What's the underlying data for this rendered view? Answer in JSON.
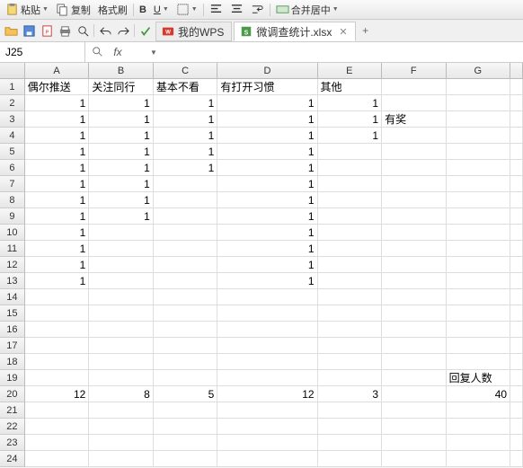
{
  "toolbar": {
    "paste_label": "粘贴",
    "copy_label": "复制",
    "format_painter_label": "格式刷",
    "merge_center_label": "合并居中"
  },
  "tabs": {
    "wps_home": "我的WPS",
    "doc_name": "微调查统计.xlsx"
  },
  "namebox": {
    "value": "J25"
  },
  "columns": [
    "A",
    "B",
    "C",
    "D",
    "E",
    "F",
    "G"
  ],
  "col_classes": [
    "cw-A",
    "cw-B",
    "cw-C",
    "cw-D",
    "cw-E",
    "cw-F",
    "cw-G"
  ],
  "row_count": 24,
  "headers_row": {
    "A": "偶尔推送",
    "B": "关注同行",
    "C": "基本不看",
    "D": "有打开习惯",
    "E": "其他"
  },
  "data": {
    "2": {
      "A": "1",
      "B": "1",
      "C": "1",
      "D": "1",
      "E": "1"
    },
    "3": {
      "A": "1",
      "B": "1",
      "C": "1",
      "D": "1",
      "E": "1",
      "F": "有奖"
    },
    "4": {
      "A": "1",
      "B": "1",
      "C": "1",
      "D": "1",
      "E": "1"
    },
    "5": {
      "A": "1",
      "B": "1",
      "C": "1",
      "D": "1"
    },
    "6": {
      "A": "1",
      "B": "1",
      "C": "1",
      "D": "1"
    },
    "7": {
      "A": "1",
      "B": "1",
      "D": "1"
    },
    "8": {
      "A": "1",
      "B": "1",
      "D": "1"
    },
    "9": {
      "A": "1",
      "B": "1",
      "D": "1"
    },
    "10": {
      "A": "1",
      "D": "1"
    },
    "11": {
      "A": "1",
      "D": "1"
    },
    "12": {
      "A": "1",
      "D": "1"
    },
    "13": {
      "A": "1",
      "D": "1"
    },
    "19": {
      "G": "回复人数"
    },
    "20": {
      "A": "12",
      "B": "8",
      "C": "5",
      "D": "12",
      "E": "3",
      "G": "40"
    }
  },
  "text_cells": [
    [
      1,
      "A"
    ],
    [
      1,
      "B"
    ],
    [
      1,
      "C"
    ],
    [
      1,
      "D"
    ],
    [
      1,
      "E"
    ],
    [
      3,
      "F"
    ],
    [
      19,
      "G"
    ]
  ]
}
